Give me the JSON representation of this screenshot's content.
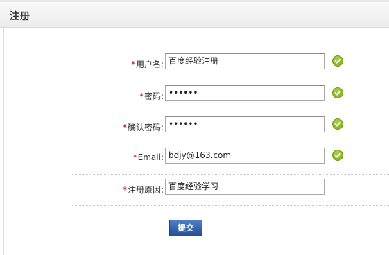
{
  "header": {
    "title": "注册"
  },
  "form": {
    "required_mark": "*",
    "fields": [
      {
        "label": "用户名:",
        "value": "百度经验注册",
        "valid": true
      },
      {
        "label": "密码:",
        "value": "••••••",
        "valid": true
      },
      {
        "label": "确认密码:",
        "value": "••••••",
        "valid": true
      },
      {
        "label": "Email:",
        "value": "bdjy@163.com",
        "valid": true
      },
      {
        "label": "注册原因:",
        "value": "百度经验学习",
        "valid": false
      }
    ],
    "submit_label": "提交"
  },
  "colors": {
    "required": "#cc0000",
    "check": "#8dbb2a",
    "submit": "#2c5aa0"
  },
  "icons": {
    "valid": "check-circle-icon"
  }
}
